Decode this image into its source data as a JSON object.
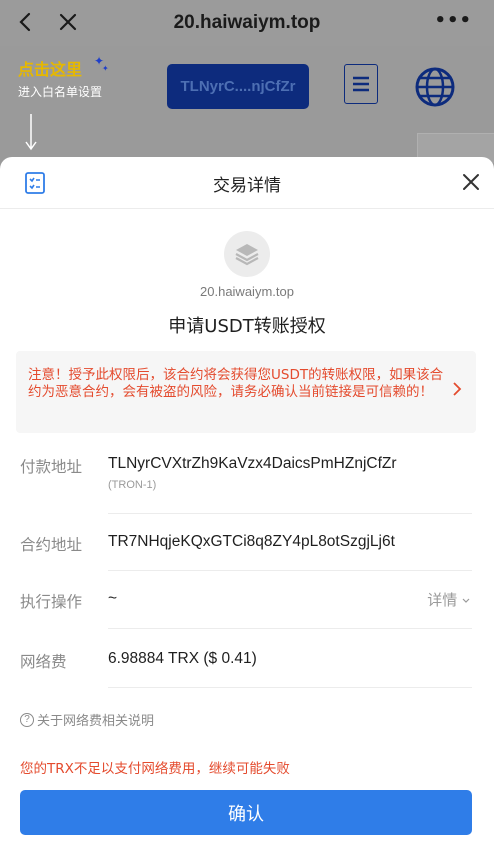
{
  "browser": {
    "url": "20.haiwaiym.top",
    "more_label": "•••"
  },
  "background_page": {
    "hint_title": "点击这里",
    "hint_subtitle": "进入白名单设置",
    "address_button": "TLNyrC....njCfZr"
  },
  "sheet": {
    "title": "交易详情",
    "dapp_domain": "20.haiwaiym.top",
    "request_title": "申请USDT转账授权",
    "warning": "注意！授予此权限后，该合约将会获得您USDT的转账权限，如果该合约为恶意合约，会有被盗的风险，请务必确认当前链接是可信赖的！",
    "rows": [
      {
        "label": "付款地址",
        "value": "TLNyrCVXtrZh9KaVzx4DaicsPmHZnjCfZr",
        "sub": "(TRON-1)"
      },
      {
        "label": "合约地址",
        "value": "TR7NHqjeKQxGTCi8q8ZY4pL8otSzgjLj6t"
      },
      {
        "label": "执行操作",
        "value": "~",
        "action": "详情"
      },
      {
        "label": "网络费",
        "value": "6.98884 TRX ($ 0.41)"
      }
    ],
    "fee_help": "关于网络费相关说明",
    "insufficient_notice": "您的TRX不足以支付网络费用，继续可能失败",
    "confirm_label": "确认"
  },
  "colors": {
    "accent": "#2f7de8",
    "warning": "#e44b2e",
    "hint": "#e6b800",
    "dim_background": "#9a9a9a"
  },
  "icons": [
    "back-arrow-icon",
    "close-icon",
    "more-icon",
    "menu-icon",
    "globe-icon",
    "list-icon",
    "layers-icon",
    "chevron-right-icon",
    "help-circle-icon",
    "chevron-down-icon"
  ]
}
